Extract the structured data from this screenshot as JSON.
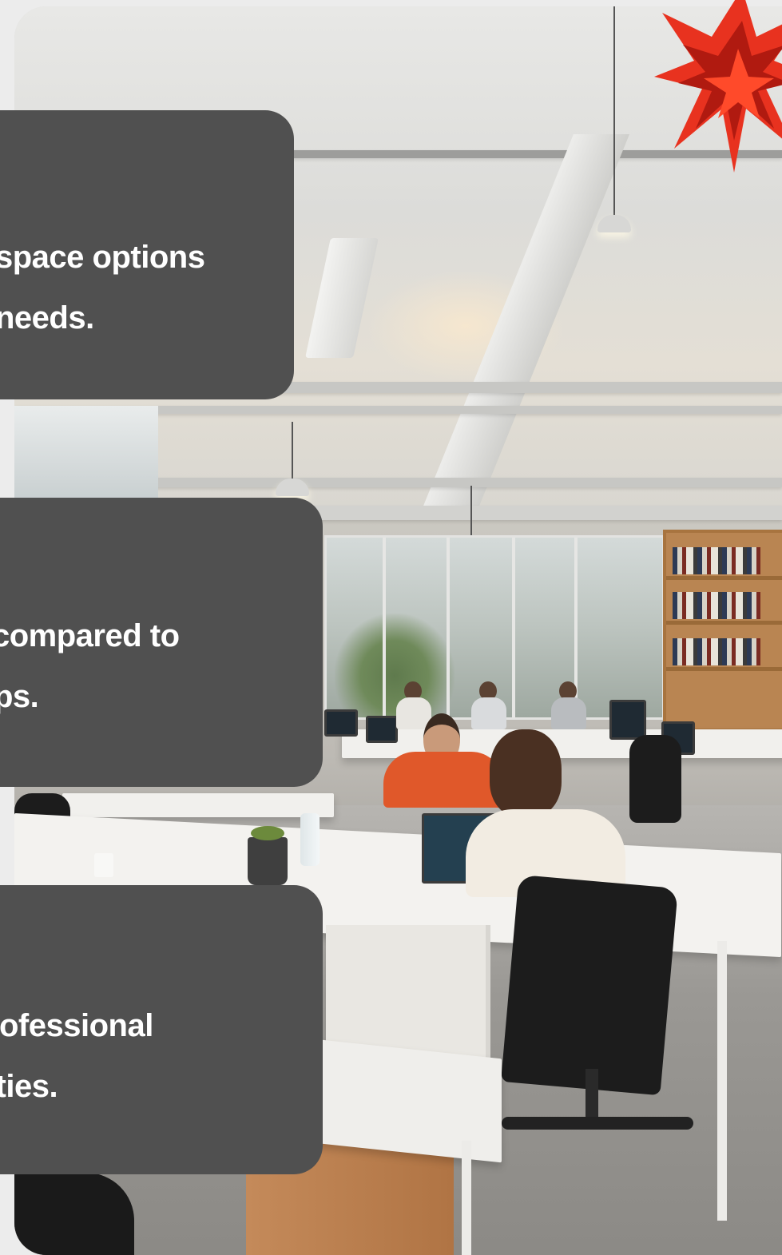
{
  "photo": {
    "subject": "office-workspace-photo"
  },
  "logo": {
    "icon": "red-star-burst-icon",
    "colors": [
      "#e8321f",
      "#b01a10",
      "#ff4a2a"
    ]
  },
  "cards": [
    {
      "line1": "space options",
      "line2": "needs."
    },
    {
      "line1": "compared to",
      "line2": "ps."
    },
    {
      "line1": "professional",
      "line2": "nities."
    }
  ],
  "colors": {
    "card_bg": "#505050",
    "card_text": "#ffffff",
    "page_bg": "#ececec"
  }
}
